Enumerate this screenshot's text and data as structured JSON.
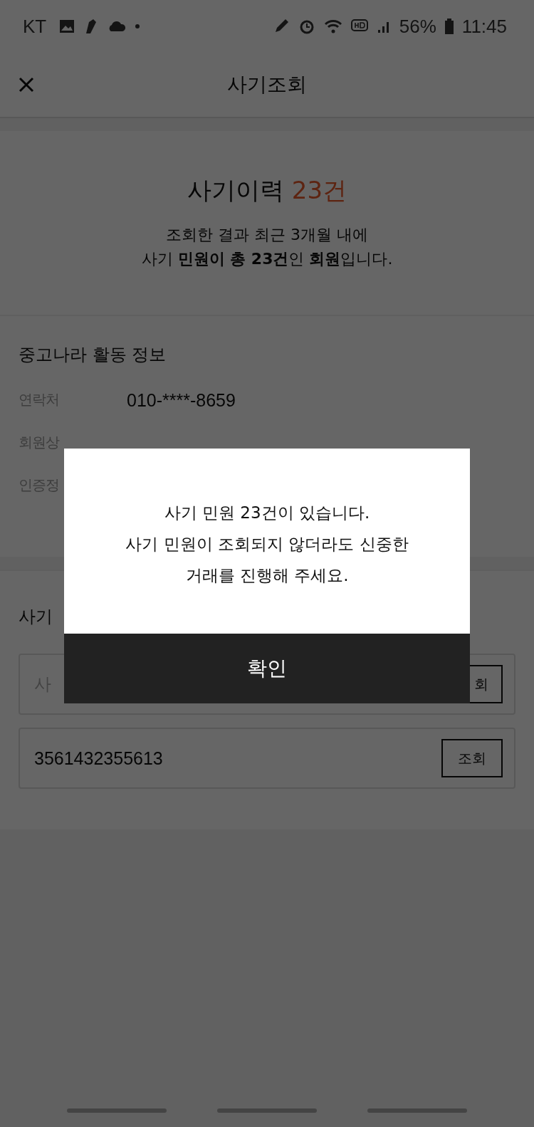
{
  "status_bar": {
    "carrier": "KT",
    "battery": "56%",
    "time": "11:45"
  },
  "header": {
    "title": "사기조회"
  },
  "result": {
    "title": "사기이력",
    "count": "23건",
    "description": [
      "조회한 결과 최근 3개월 내에",
      "사기 **민원이 총 23건**인 **회원**입니다."
    ]
  },
  "activity": {
    "title": "중고나라 활동 정보",
    "rows": [
      {
        "label": "연락처",
        "value": "010-****-8659"
      },
      {
        "label": "회원상"
      },
      {
        "label": "인증정"
      }
    ]
  },
  "search": {
    "title": "사기",
    "fields": [
      {
        "placeholder": "사",
        "button": "회"
      },
      {
        "value": "3561432355613",
        "button": "조회"
      }
    ]
  },
  "dialog": {
    "message": [
      "사기 민원 23건이 있습니다.",
      "사기 민원이 조회되지 않더라도 신중한",
      "거래를 진행해 주세요."
    ],
    "confirm": "확인"
  }
}
